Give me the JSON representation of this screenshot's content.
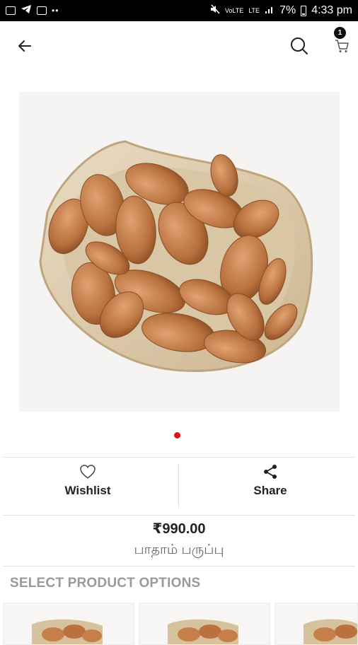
{
  "status_bar": {
    "time": "4:33 pm",
    "battery": "7%",
    "volte": "VoLTE",
    "lte": "LTE",
    "left_dots": "••"
  },
  "app_bar": {
    "cart_count": "1",
    "icons": [
      "back-arrow-icon",
      "search-icon",
      "cart-icon"
    ]
  },
  "product": {
    "image_label": "almonds in a ceramic dish",
    "price": "₹990.00",
    "name": "பாதாம் பருப்பு",
    "pager": {
      "count": 1,
      "active": 0
    }
  },
  "actions": {
    "wishlist_label": "Wishlist",
    "share_label": "Share"
  },
  "options": {
    "title": "SELECT PRODUCT OPTIONS",
    "cards": 3
  },
  "colors": {
    "accent": "#e0111b",
    "badge": "#111111",
    "heading_muted": "#9a9a9a"
  }
}
